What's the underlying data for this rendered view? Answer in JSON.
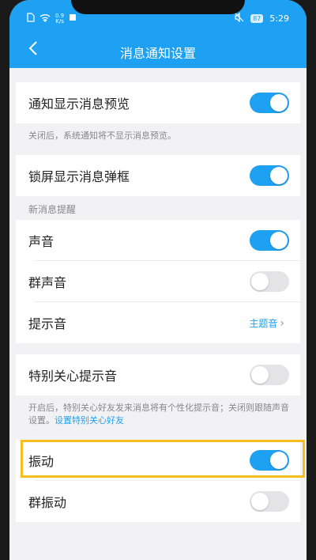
{
  "status_bar": {
    "net_speed_top": "0.9",
    "net_speed_bottom": "K/s",
    "battery": "87",
    "time": "5:29"
  },
  "header": {
    "title": "消息通知设置"
  },
  "settings": {
    "preview": {
      "label": "通知显示消息预览",
      "on": true
    },
    "preview_hint": "关闭后，系统通知将不显示消息预览。",
    "lockscreen": {
      "label": "锁屏显示消息弹框",
      "on": true
    },
    "new_msg_section": "新消息提醒",
    "sound": {
      "label": "声音",
      "on": true
    },
    "group_sound": {
      "label": "群声音",
      "on": false
    },
    "tone": {
      "label": "提示音",
      "value": "主题音"
    },
    "special_care": {
      "label": "特别关心提示音",
      "on": false
    },
    "special_hint": "开启后，特别关心好友发来消息将有个性化提示音；关闭则跟随声音设置。",
    "special_hint_link": "设置特别关心好友",
    "vibrate": {
      "label": "振动",
      "on": true
    },
    "group_vibrate": {
      "label": "群振动",
      "on": false
    }
  },
  "colors": {
    "accent": "#1ea1f2",
    "highlight": "#f7bd1e"
  },
  "icons": {
    "back": "chevron-left-icon",
    "chevron": "chevron-right-icon"
  }
}
